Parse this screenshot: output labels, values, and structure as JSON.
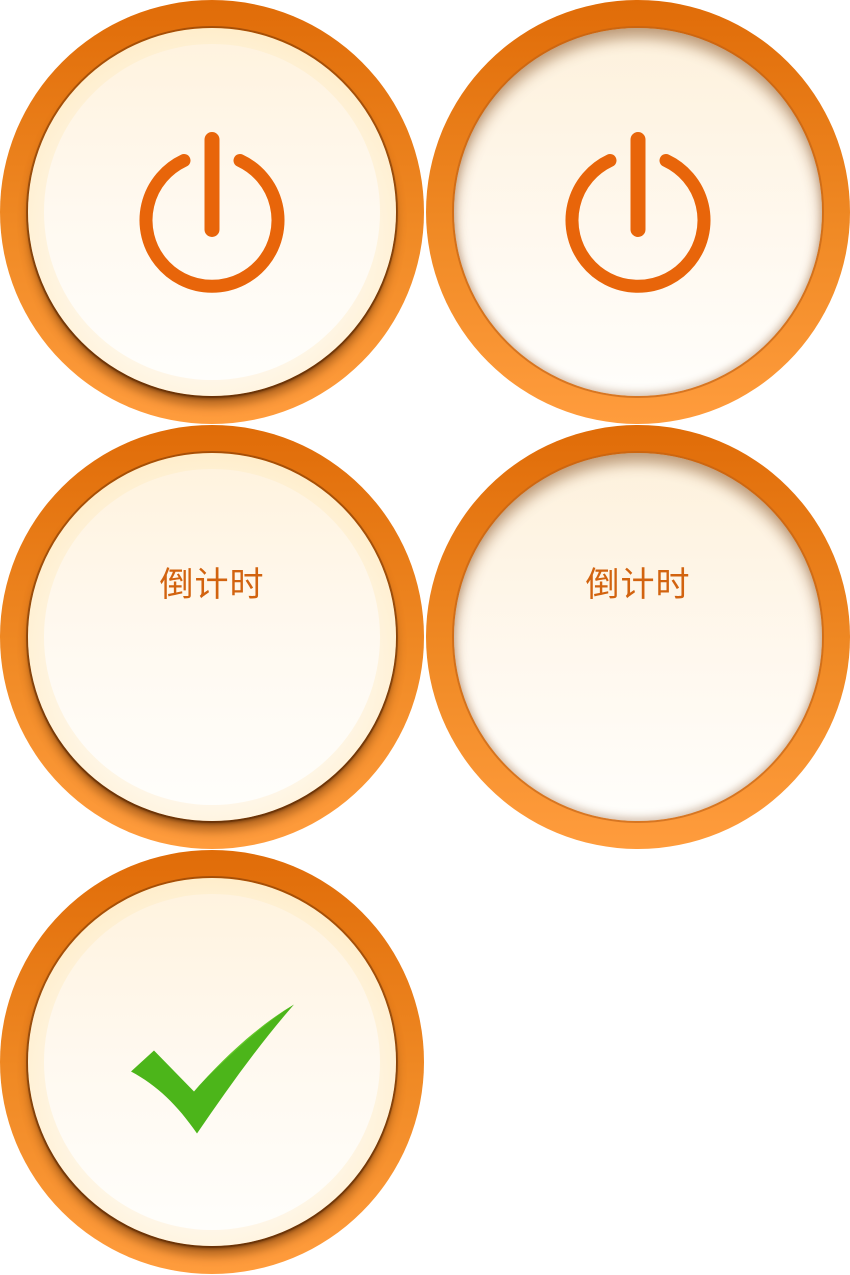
{
  "buttons": {
    "power_normal": {
      "icon": "power-icon"
    },
    "power_pressed": {
      "icon": "power-icon"
    },
    "countdown_normal": {
      "label": "倒计时"
    },
    "countdown_pressed": {
      "label": "倒计时"
    },
    "confirm_normal": {
      "icon": "checkmark-icon"
    }
  },
  "colors": {
    "ring": "#f08a25",
    "face": "#fff8ec",
    "icon": "#e8650a",
    "label": "#d2630f",
    "check": "#4cb51a"
  }
}
